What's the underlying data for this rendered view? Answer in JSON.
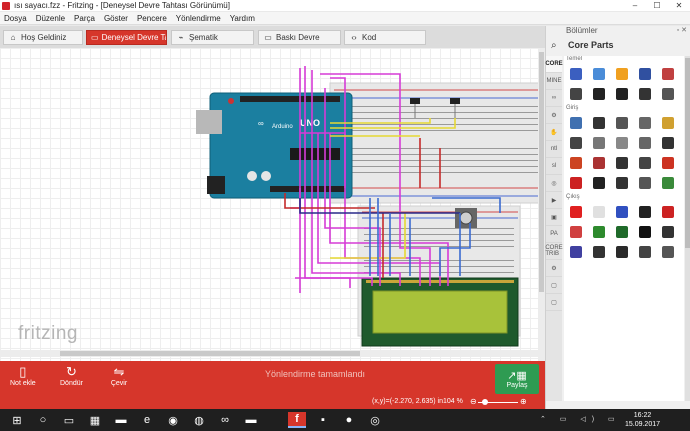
{
  "window": {
    "title": "ısı sayacı.fzz - Fritzing - [Deneysel Devre Tahtası Görünümü]",
    "controls": [
      "–",
      "☐",
      "✕"
    ]
  },
  "menu": [
    "Dosya",
    "Düzenle",
    "Parça",
    "Göster",
    "Pencere",
    "Yönlendirme",
    "Yardım"
  ],
  "tabs": [
    {
      "label": "Hoş Geldiniz",
      "icon": "home-icon",
      "glyph": "⌂"
    },
    {
      "label": "Deneysel Devre Tahtası",
      "icon": "breadboard-icon",
      "glyph": "▭",
      "active": true
    },
    {
      "label": "Şematik",
      "icon": "schematic-icon",
      "glyph": "⌁"
    },
    {
      "label": "Baskı Devre",
      "icon": "pcb-icon",
      "glyph": "▭"
    },
    {
      "label": "Kod",
      "icon": "code-icon",
      "glyph": "‹›"
    }
  ],
  "canvas": {
    "logo": "fritzing"
  },
  "toolbar": {
    "add_note": "Not ekle",
    "rotate": "Döndür",
    "flip": "Çevir",
    "routing_status": "Yönlendirme tamamlandı",
    "share": "Paylaş"
  },
  "status": {
    "coords": "(x,y)=(-2.270, 2.635) in",
    "zoom": "104 %"
  },
  "parts_panel": {
    "header": "Bölümler",
    "bin_title": "Core Parts",
    "bin_tabs": [
      "CORE",
      "MINE",
      "∞",
      "⚙",
      "✋",
      "ntl",
      "sl",
      "◎",
      "▶",
      "▣",
      "PA",
      "CORE TRIB",
      "⚙",
      "▢",
      "▢"
    ],
    "sections": [
      {
        "label": "Temel",
        "parts": [
          {
            "name": "resistor-part",
            "color": "#3b5fc0"
          },
          {
            "name": "rotary-potentiometer-part",
            "color": "#4a8cd8"
          },
          {
            "name": "capacitor-ceramic-part",
            "color": "#f0a020"
          },
          {
            "name": "capacitor-electrolytic-part",
            "color": "#3050a0"
          },
          {
            "name": "inductor-part",
            "color": "#c04040"
          },
          {
            "name": "diode-part",
            "color": "#444444"
          },
          {
            "name": "transistor-npn-part",
            "color": "#222222"
          },
          {
            "name": "transistor-pnp-part",
            "color": "#222222"
          },
          {
            "name": "mosfet-part",
            "color": "#333333"
          },
          {
            "name": "voltage-regulator-part",
            "color": "#555555"
          }
        ]
      },
      {
        "label": "Giriş",
        "parts": [
          {
            "name": "ir-sensor-part",
            "color": "#4070b0"
          },
          {
            "name": "microphone-part",
            "color": "#333333"
          },
          {
            "name": "button-part",
            "color": "#555555"
          },
          {
            "name": "slide-switch-part",
            "color": "#666666"
          },
          {
            "name": "keypad-part",
            "color": "#d0a030"
          },
          {
            "name": "potentiometer-part",
            "color": "#444444"
          },
          {
            "name": "switch-part",
            "color": "#777777"
          },
          {
            "name": "tilt-switch-part",
            "color": "#888888"
          },
          {
            "name": "reed-switch-part",
            "color": "#666666"
          },
          {
            "name": "accelerometer-part",
            "color": "#333333"
          },
          {
            "name": "photocell-part",
            "color": "#cc4422"
          },
          {
            "name": "thermistor-part",
            "color": "#aa3333"
          },
          {
            "name": "temperature-sensor-part",
            "color": "#333333"
          },
          {
            "name": "pressure-sensor-part",
            "color": "#444444"
          },
          {
            "name": "gps-module-part",
            "color": "#cc3322"
          },
          {
            "name": "humidity-sensor-part",
            "color": "#cc2222"
          },
          {
            "name": "ultrasonic-sensor-part",
            "color": "#222222"
          },
          {
            "name": "hall-sensor-part",
            "color": "#333333"
          },
          {
            "name": "force-sensor-part",
            "color": "#555555"
          },
          {
            "name": "antenna-part",
            "color": "#3a8a3a"
          }
        ]
      },
      {
        "label": "Çıkış",
        "parts": [
          {
            "name": "led-red-part",
            "color": "#e02020"
          },
          {
            "name": "rgb-led-part",
            "color": "#e0e0e0"
          },
          {
            "name": "led-matrix-part",
            "color": "#3050c0"
          },
          {
            "name": "neopixel-part",
            "color": "#222222"
          },
          {
            "name": "seven-segment-part",
            "color": "#cc2222"
          },
          {
            "name": "led-array-part",
            "color": "#d04040"
          },
          {
            "name": "lcd-display-part",
            "color": "#2d8a2d"
          },
          {
            "name": "oled-display-part",
            "color": "#1f6a2a"
          },
          {
            "name": "buzzer-part",
            "color": "#111111"
          },
          {
            "name": "speaker-part",
            "color": "#333333"
          },
          {
            "name": "motor-part",
            "color": "#4040a0"
          },
          {
            "name": "servo-part",
            "color": "#333333"
          },
          {
            "name": "stepper-part",
            "color": "#2a2a2a"
          },
          {
            "name": "relay-part",
            "color": "#444444"
          },
          {
            "name": "solenoid-part",
            "color": "#555555"
          }
        ]
      }
    ]
  },
  "taskbar": {
    "clock_time": "16:22",
    "clock_date": "15.09.2017",
    "icons": [
      {
        "name": "start-icon",
        "glyph": "⊞"
      },
      {
        "name": "search-icon",
        "glyph": "○"
      },
      {
        "name": "task-view-icon",
        "glyph": "▭"
      },
      {
        "name": "store-icon",
        "glyph": "▦"
      },
      {
        "name": "file-explorer-icon",
        "glyph": "▬"
      },
      {
        "name": "edge-icon",
        "glyph": "e"
      },
      {
        "name": "chrome-icon",
        "glyph": "◉"
      },
      {
        "name": "firefox-icon",
        "glyph": "◍"
      },
      {
        "name": "arduino-icon",
        "glyph": "∞"
      },
      {
        "name": "explorer-folder-icon",
        "glyph": "▬"
      },
      {
        "name": "fritzing-taskbar-icon",
        "glyph": "f",
        "active": true
      },
      {
        "name": "app-icon-dark",
        "glyph": "▪"
      },
      {
        "name": "record-icon",
        "glyph": "●"
      },
      {
        "name": "camtasia-icon",
        "glyph": "◎"
      }
    ],
    "tray": "⌃ ▭ ◁) ▭"
  }
}
